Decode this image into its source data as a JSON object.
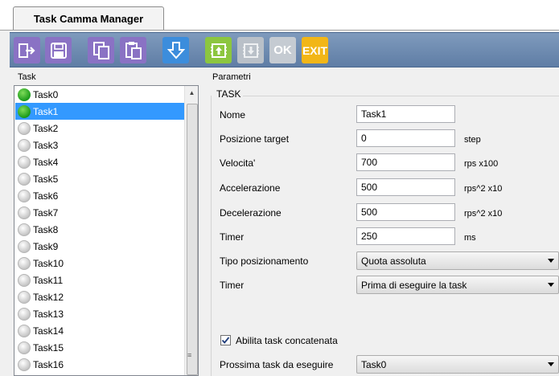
{
  "app": {
    "tab_title": "Task Camma Manager"
  },
  "toolbar": {
    "buttons": [
      {
        "name": "export-icon",
        "color": "#8a72c4",
        "enabled": true
      },
      {
        "name": "save-icon",
        "color": "#8a72c4",
        "enabled": true
      },
      {
        "name": "copy-icon",
        "color": "#8a72c4",
        "enabled": true
      },
      {
        "name": "paste-icon",
        "color": "#8a72c4",
        "enabled": true
      },
      {
        "name": "download-icon",
        "color": "#3c8ddc",
        "enabled": true
      },
      {
        "name": "chip-upload-icon",
        "color": "#8cc63f",
        "enabled": true
      },
      {
        "name": "chip-download-icon",
        "color": "#b9c0c8",
        "enabled": false
      },
      {
        "name": "ok",
        "label": "OK",
        "color": "#c5cbd2",
        "enabled": false
      },
      {
        "name": "exit",
        "label": "EXIT",
        "color": "#f2b617",
        "enabled": true
      }
    ]
  },
  "task_panel": {
    "label": "Task",
    "selected_index": 1,
    "tasks": [
      {
        "label": "Task0",
        "status": "green"
      },
      {
        "label": "Task1",
        "status": "green"
      },
      {
        "label": "Task2",
        "status": "gray"
      },
      {
        "label": "Task3",
        "status": "gray"
      },
      {
        "label": "Task4",
        "status": "gray"
      },
      {
        "label": "Task5",
        "status": "gray"
      },
      {
        "label": "Task6",
        "status": "gray"
      },
      {
        "label": "Task7",
        "status": "gray"
      },
      {
        "label": "Task8",
        "status": "gray"
      },
      {
        "label": "Task9",
        "status": "gray"
      },
      {
        "label": "Task10",
        "status": "gray"
      },
      {
        "label": "Task11",
        "status": "gray"
      },
      {
        "label": "Task12",
        "status": "gray"
      },
      {
        "label": "Task13",
        "status": "gray"
      },
      {
        "label": "Task14",
        "status": "gray"
      },
      {
        "label": "Task15",
        "status": "gray"
      },
      {
        "label": "Task16",
        "status": "gray"
      }
    ]
  },
  "params": {
    "label": "Parametri",
    "group_title": "TASK",
    "fields": {
      "nome": {
        "label": "Nome",
        "value": "Task1"
      },
      "posizione": {
        "label": "Posizione target",
        "value": "0",
        "unit": "step"
      },
      "velocita": {
        "label": "Velocita'",
        "value": "700",
        "unit": "rps x100"
      },
      "accelerazione": {
        "label": "Accelerazione",
        "value": "500",
        "unit": "rps^2 x10"
      },
      "decelerazione": {
        "label": "Decelerazione",
        "value": "500",
        "unit": "rps^2 x10"
      },
      "timer": {
        "label": "Timer",
        "value": "250",
        "unit": "ms"
      }
    },
    "tipo_posizionamento": {
      "label": "Tipo posizionamento",
      "value": "Quota assoluta"
    },
    "timer_mode": {
      "label": "Timer",
      "value": "Prima di eseguire la task"
    },
    "abilita": {
      "label": "Abilita task concatenata",
      "checked": true
    },
    "prossima": {
      "label": "Prossima task da eseguire",
      "value": "Task0"
    }
  }
}
